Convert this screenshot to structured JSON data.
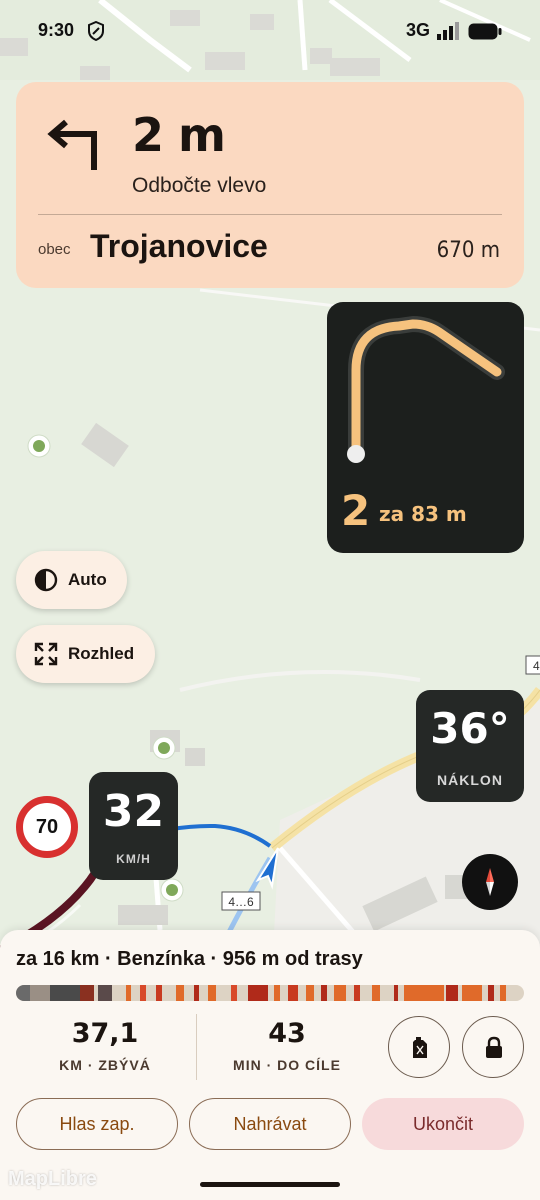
{
  "status_bar": {
    "time": "9:30",
    "network": "3G"
  },
  "instruction": {
    "distance": "2 m",
    "action": "Odbočte vlevo",
    "road_prefix": "obec",
    "road_name": "Trojanovice",
    "road_distance": "670 m"
  },
  "next_turn": {
    "number": "2",
    "distance": "za 83 m"
  },
  "controls": {
    "theme_label": "Auto",
    "overview_label": "Rozhled"
  },
  "tilt": {
    "value": "36°",
    "label": "NÁKLON"
  },
  "speed_limit": "70",
  "speed": {
    "value": "32",
    "unit": "KM/H"
  },
  "map_labels": {
    "road_number": "4…6",
    "edge_number": "4",
    "attribution": "MapLibre"
  },
  "bottom_sheet": {
    "poi": "za 16 km · Benzínka · 956 m od trasy",
    "remaining": {
      "value": "37,1",
      "label": "KM · ZBÝVÁ"
    },
    "eta": {
      "value": "43",
      "label": "MIN · DO CÍLE"
    },
    "buttons": {
      "voice": "Hlas zap.",
      "record": "Nahrávat",
      "end": "Ukončit"
    }
  },
  "colors": {
    "card_bg": "#fbd9c1",
    "dark_panel": "#252826",
    "accent_orange": "#f6c27e",
    "route_blue": "#1f6fd1",
    "speed_limit_red": "#d8302f"
  }
}
